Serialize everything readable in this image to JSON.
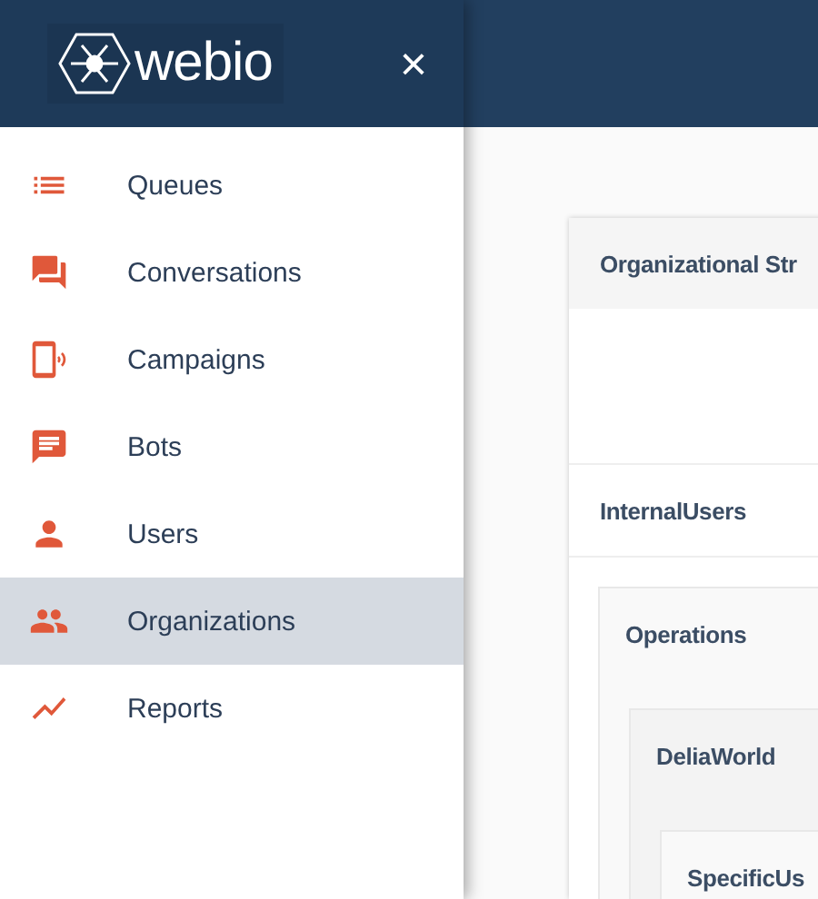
{
  "header": {
    "logo": "webio",
    "close": "×"
  },
  "sidebar": {
    "items": [
      {
        "label": "Queues",
        "selected": false
      },
      {
        "label": "Conversations",
        "selected": false
      },
      {
        "label": "Campaigns",
        "selected": false
      },
      {
        "label": "Bots",
        "selected": false
      },
      {
        "label": "Users",
        "selected": false
      },
      {
        "label": "Organizations",
        "selected": true
      },
      {
        "label": "Reports",
        "selected": false
      }
    ]
  },
  "panel": {
    "title": "Organizational Str",
    "root": "InternalUsers",
    "tree": [
      {
        "label": "Operations",
        "children": [
          {
            "label": "DeliaWorld",
            "children": [
              {
                "label": "SpecificUs"
              }
            ]
          }
        ]
      }
    ]
  }
}
